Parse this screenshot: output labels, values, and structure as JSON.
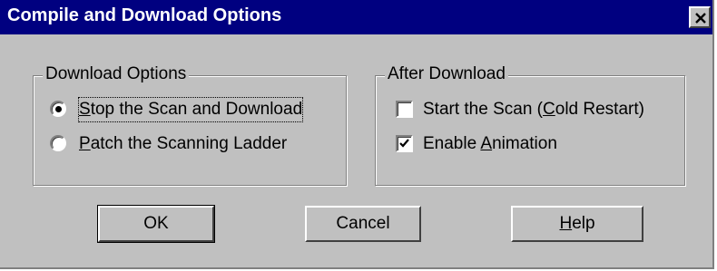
{
  "window": {
    "title": "Compile and Download Options",
    "close_icon": "close-icon"
  },
  "download_options": {
    "label": "Download Options",
    "options": [
      {
        "pre": "",
        "accel": "S",
        "post": "top the Scan and Download",
        "selected": true
      },
      {
        "pre": "",
        "accel": "P",
        "post": "atch the Scanning Ladder",
        "selected": false
      }
    ]
  },
  "after_download": {
    "label": "After Download",
    "options": [
      {
        "pre": "Start the Scan (",
        "accel": "C",
        "post": "old Restart)",
        "checked": false
      },
      {
        "pre": "Enable ",
        "accel": "A",
        "post": "nimation",
        "checked": true
      }
    ]
  },
  "buttons": {
    "ok": {
      "pre": "",
      "accel": "",
      "post": "OK"
    },
    "cancel": {
      "pre": "",
      "accel": "",
      "post": "Cancel"
    },
    "help": {
      "pre": "",
      "accel": "H",
      "post": "elp"
    }
  },
  "colors": {
    "title_bar": "#000080",
    "face": "#c0c0c0"
  }
}
